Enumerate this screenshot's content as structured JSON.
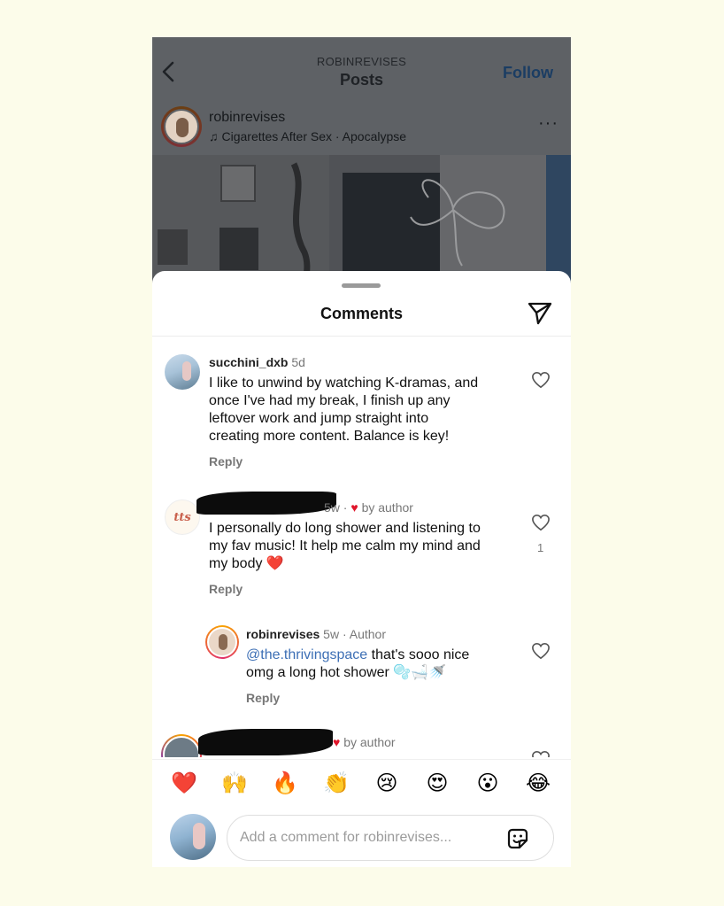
{
  "header": {
    "username": "ROBINREVISES",
    "title": "Posts",
    "follow_label": "Follow"
  },
  "post": {
    "username": "robinrevises",
    "music": "Cigarettes After Sex · Apocalypse",
    "more": "···"
  },
  "sheet": {
    "title": "Comments"
  },
  "comments": [
    {
      "username": "succhini_dxb",
      "time": "5d",
      "lines": [
        "I like to unwind by watching K-dramas, and",
        "once I've had my break, I finish up any",
        "leftover work and jump straight into",
        "creating more content. Balance is key!"
      ],
      "reply_label": "Reply"
    },
    {
      "avatar_text": "tts",
      "time": "5w",
      "liked_by": "by author",
      "lines": [
        "I personally do long shower and listening to",
        "my fav music! It help me calm my mind and",
        "my body ❤️"
      ],
      "likes": "1",
      "reply_label": "Reply"
    },
    {
      "username": "robinrevises",
      "time": "5w",
      "badge": "Author",
      "mention": "@the.thrivingspace",
      "line1_rest": " that's sooo nice",
      "line2": "omg a long hot shower 🫧🛁🚿",
      "reply_label": "Reply"
    },
    {
      "liked_by": "by author"
    }
  ],
  "emoji_bar": [
    "❤️",
    "🙌",
    "🔥",
    "👏",
    "😢",
    "😍",
    "😮",
    "😂"
  ],
  "input": {
    "placeholder": "Add a comment for robinrevises..."
  },
  "colors": {
    "background": "#fcfcea",
    "heart": "#e0162b",
    "mention": "#3d6fb5",
    "follow": "#1b3d63"
  },
  "icons": {
    "back": "chevron-left-icon",
    "share": "paper-plane-icon",
    "heart": "heart-outline-icon",
    "sticker": "sticker-icon",
    "music": "music-note-icon"
  }
}
